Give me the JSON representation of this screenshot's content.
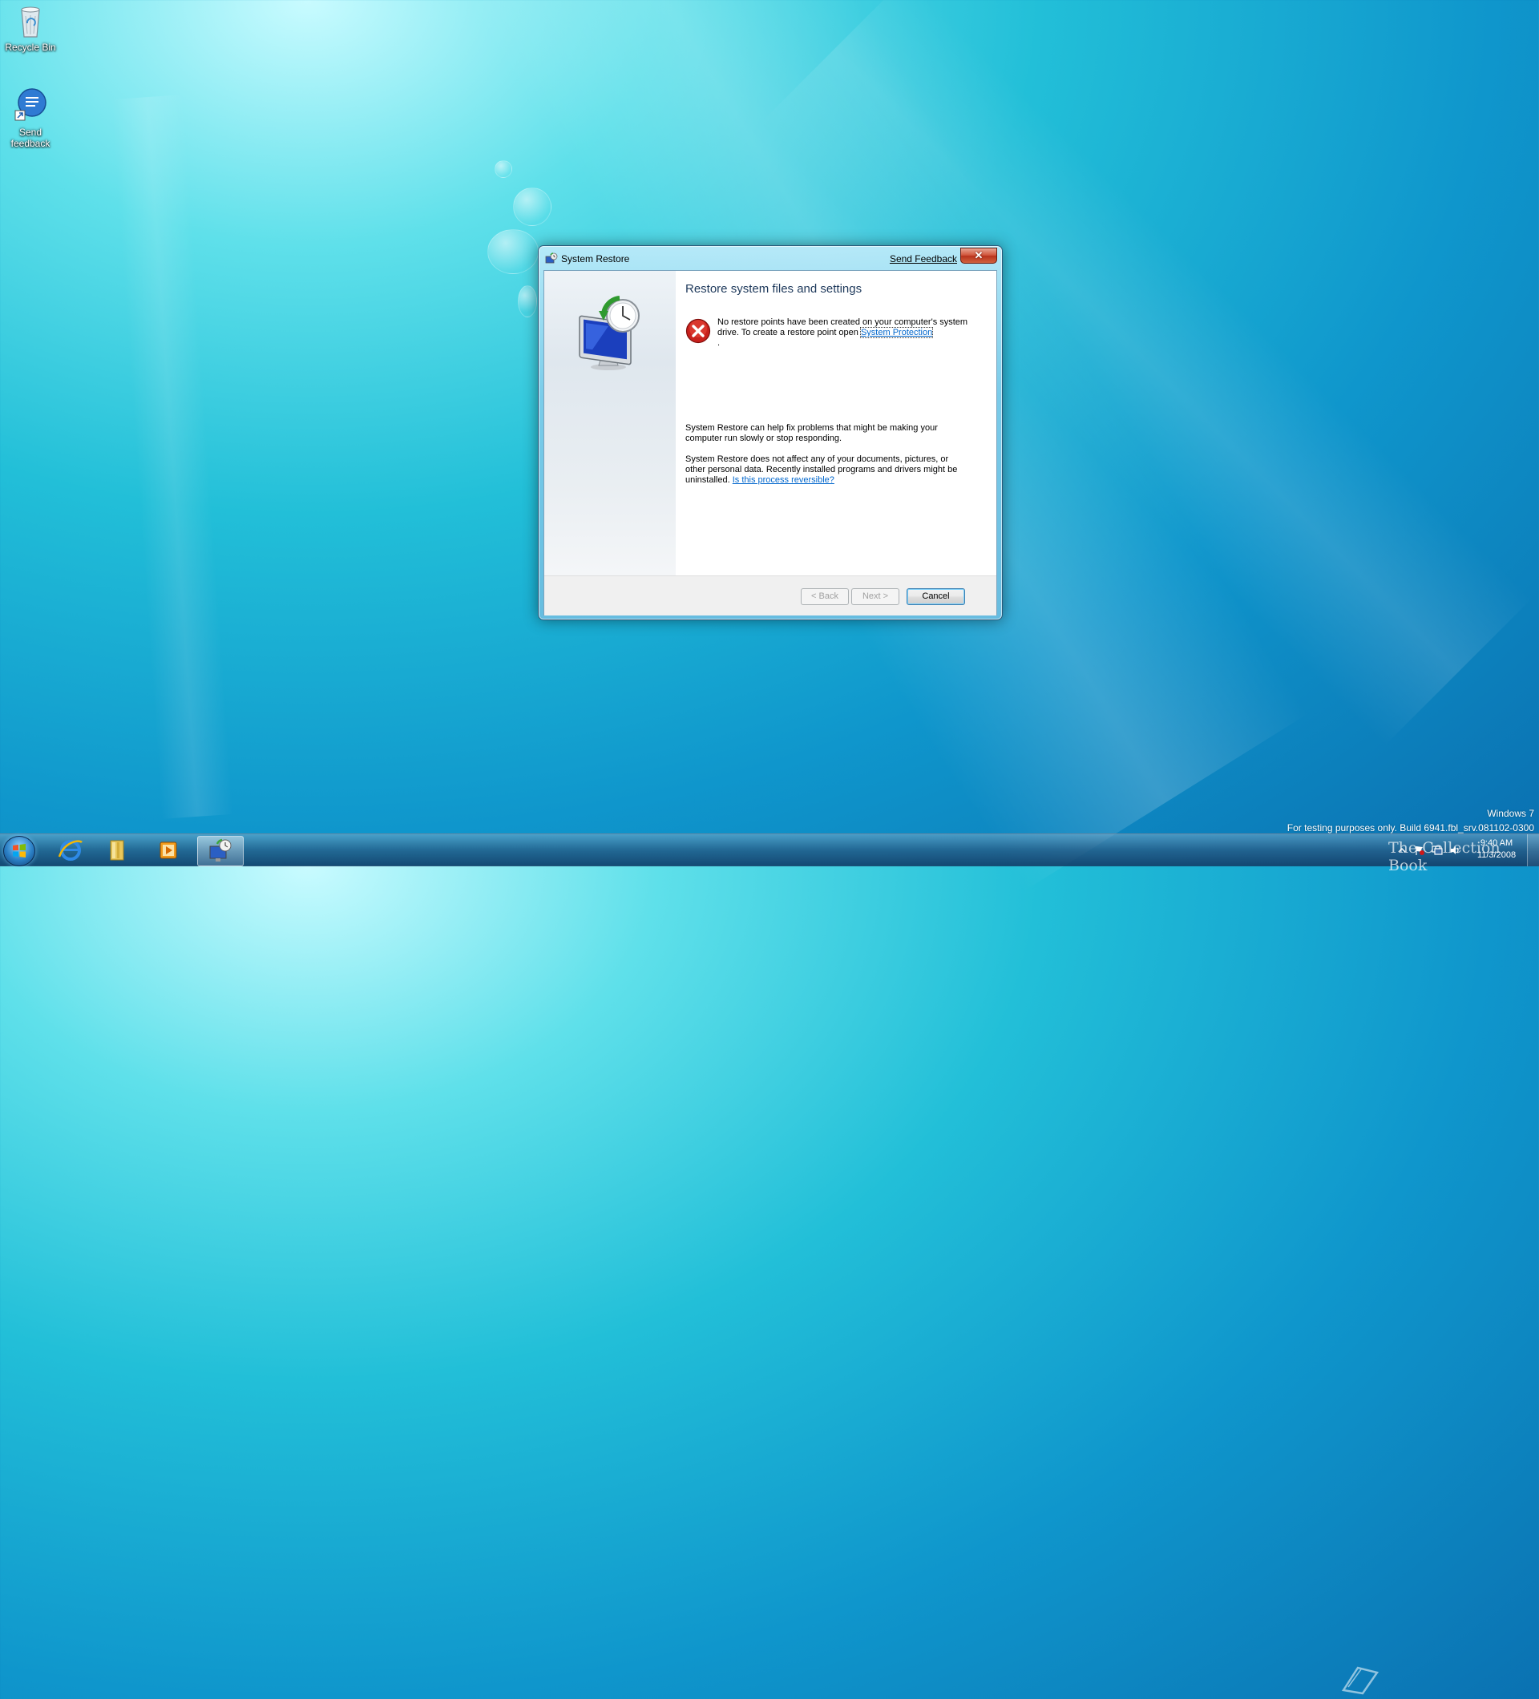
{
  "desktop": {
    "icons": [
      {
        "label": "Recycle Bin",
        "icon": "recycle-bin-icon"
      },
      {
        "label": "Send feedback",
        "icon": "send-feedback-icon"
      }
    ]
  },
  "dialog": {
    "title": "System Restore",
    "title_icon": "system-restore-icon",
    "feedback_link": "Send Feedback",
    "close_glyph": "✕",
    "heading": "Restore system files and settings",
    "error_icon": "error-icon",
    "error_text_prefix": "No restore points have been created on your computer's system drive. To create a restore point open ",
    "error_link": "System Protection",
    "error_text_suffix": ".",
    "info_paragraph_1": "System Restore can help fix problems that might be making your computer run slowly or stop responding.",
    "info_paragraph_2_prefix": "System Restore does not affect any of your documents, pictures, or other personal data. Recently installed programs and drivers might be uninstalled. ",
    "info_paragraph_2_link": "Is this process reversible?",
    "buttons": {
      "back": "< Back",
      "next": "Next >",
      "cancel": "Cancel"
    }
  },
  "taskbar": {
    "start": "start-orb",
    "pinned": [
      {
        "name": "internet-explorer",
        "icon": "internet-explorer-icon"
      },
      {
        "name": "windows-explorer",
        "icon": "folder-icon"
      },
      {
        "name": "media-player",
        "icon": "media-player-icon"
      },
      {
        "name": "system-restore",
        "icon": "system-restore-icon",
        "active": true
      }
    ],
    "clock_time": "9:40 AM",
    "clock_date": "11/3/2008"
  },
  "watermark": {
    "line1": "Windows 7",
    "line2": "For testing purposes only. Build 6941.fbl_srv.081102-0300",
    "logo": "The Collection Book"
  },
  "colors": {
    "accent": "#0066cc",
    "heading": "#1e395b",
    "close_red": "#c9402a",
    "error_red": "#c8201c"
  }
}
